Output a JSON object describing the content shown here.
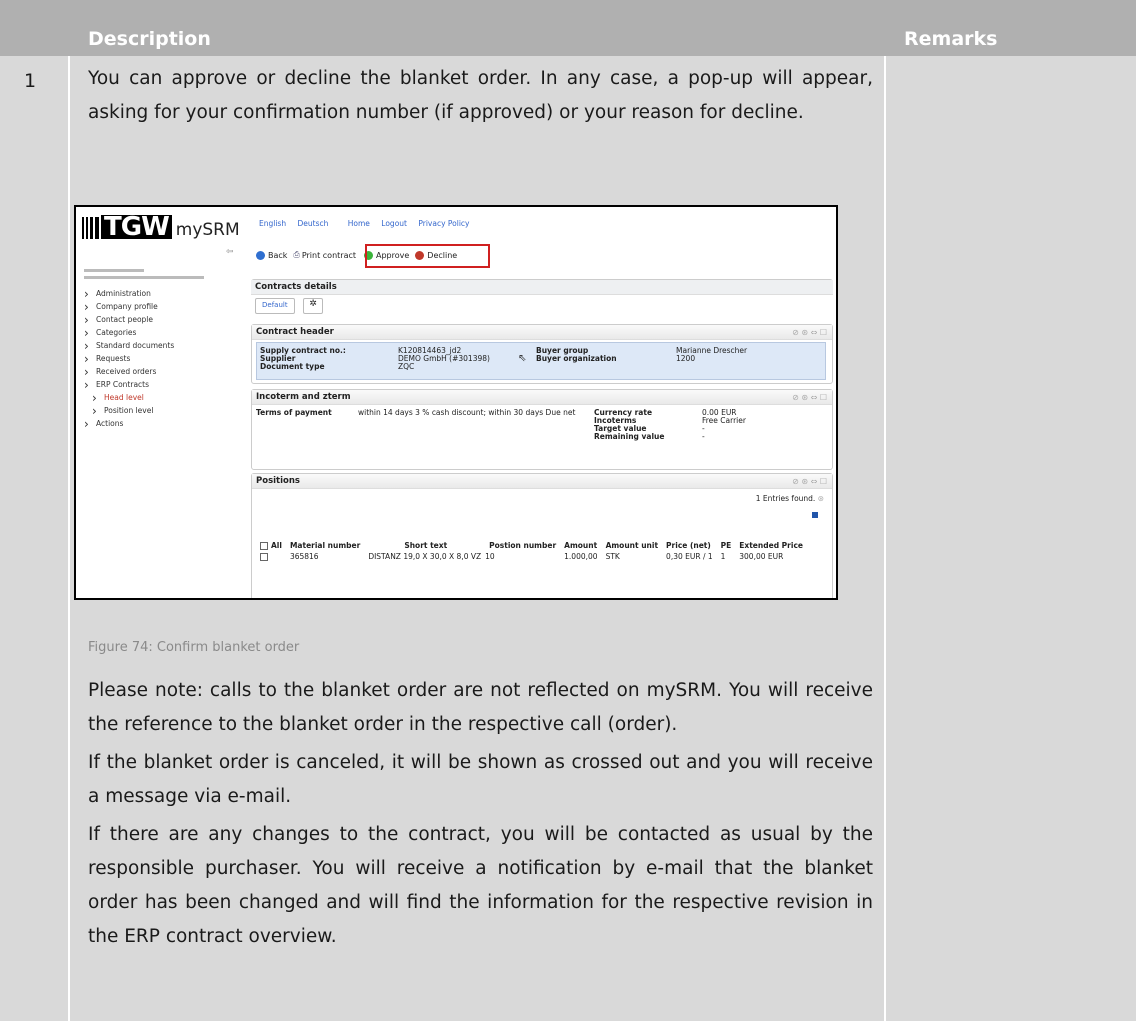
{
  "table": {
    "col_description": "Description",
    "col_remarks": "Remarks",
    "row_number": "1"
  },
  "paragraphs": {
    "p1": "You can approve or decline the blanket order. In any case, a pop-up will appear, asking for your confirmation number (if approved) or your reason for decline.",
    "p2": "Please note: calls to the blanket order are not reflected on mySRM. You will receive the reference to the blanket order in the respective call (order).",
    "p3": "If the blanket order is canceled, it will be shown as crossed out and you will receive a message via e-mail.",
    "p4": "If there are any changes to the contract, you will be contacted as usual by the responsible purchaser. You will receive a notification by e-mail that the blanket order has been changed and will find the information for the respective revision in the ERP contract overview."
  },
  "caption": "Figure 74: Confirm blanket order",
  "screenshot": {
    "logo_brand": "TGW",
    "logo_product": "mySRM",
    "top_links": [
      "English",
      "Deutsch",
      "Home",
      "Logout",
      "Privacy Policy"
    ],
    "toolbar": {
      "back": "Back",
      "print": "Print contract",
      "approve": "Approve",
      "decline": "Decline"
    },
    "sidebar": [
      {
        "label": "Administration",
        "sub": false,
        "active": false
      },
      {
        "label": "Company profile",
        "sub": false,
        "active": false
      },
      {
        "label": "Contact people",
        "sub": false,
        "active": false
      },
      {
        "label": "Categories",
        "sub": false,
        "active": false
      },
      {
        "label": "Standard documents",
        "sub": false,
        "active": false
      },
      {
        "label": "Requests",
        "sub": false,
        "active": false
      },
      {
        "label": "Received orders",
        "sub": false,
        "active": false
      },
      {
        "label": "ERP Contracts",
        "sub": false,
        "active": false
      },
      {
        "label": "Head level",
        "sub": true,
        "active": true
      },
      {
        "label": "Position level",
        "sub": true,
        "active": false
      },
      {
        "label": "Actions",
        "sub": false,
        "active": false
      }
    ],
    "contracts_details": {
      "title": "Contracts details",
      "default_btn": "Default",
      "star_btn": "✲"
    },
    "contract_header": {
      "title": "Contract header",
      "supply_contract_label": "Supply contract no.:",
      "supply_contract_value": "K120814463_jd2",
      "supplier_label": "Supplier",
      "supplier_value": "DEMO GmbH (#301398)",
      "document_type_label": "Document type",
      "document_type_value": "ZQC",
      "buyer_group_label": "Buyer group",
      "buyer_group_value": "Marianne Drescher",
      "buyer_org_label": "Buyer organization",
      "buyer_org_value": "1200"
    },
    "incoterm": {
      "title": "Incoterm and zterm",
      "terms_label": "Terms of payment",
      "terms_value": "within 14 days 3 % cash discount; within 30 days Due net",
      "currency_rate_label": "Currency rate",
      "currency_rate_value": "0.00 EUR",
      "incoterms_label": "Incoterms",
      "incoterms_value": "Free Carrier",
      "target_value_label": "Target value",
      "target_value_value": "-",
      "remaining_value_label": "Remaining value",
      "remaining_value_value": "-"
    },
    "positions": {
      "title": "Positions",
      "entries_found": "1 Entries found.",
      "columns": [
        "All",
        "Material number",
        "Short text",
        "Postion number",
        "Amount",
        "Amount unit",
        "Price (net)",
        "PE",
        "Extended Price"
      ],
      "rows": [
        [
          "365816",
          "DISTANZ 19,0 X 30,0 X 8,0 VZ",
          "10",
          "1.000,00",
          "STK",
          "0,30 EUR / 1",
          "1",
          "300,00 EUR"
        ]
      ]
    }
  }
}
